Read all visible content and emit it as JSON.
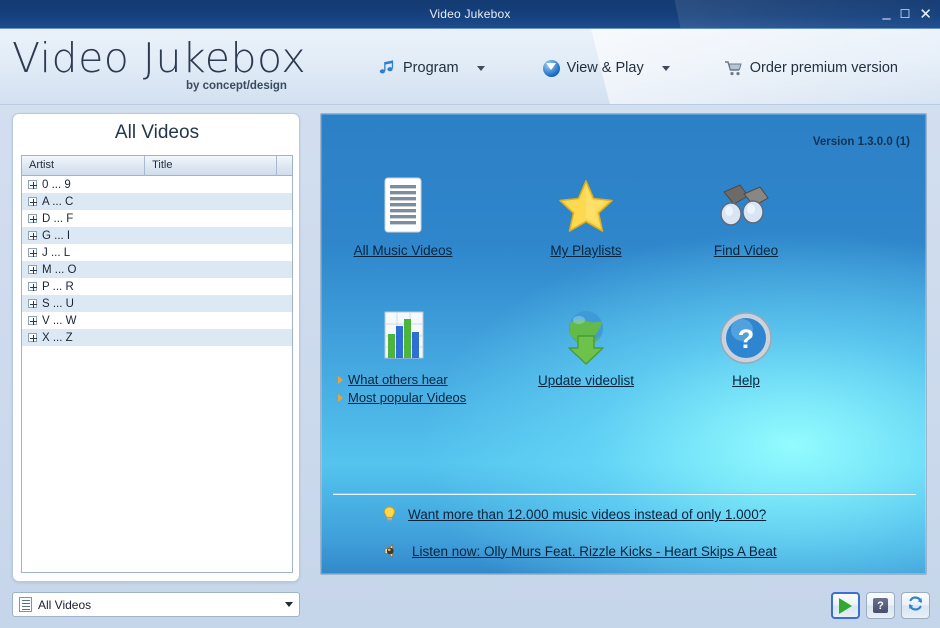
{
  "window": {
    "title": "Video Jukebox",
    "minimize": "–",
    "maximize": "❐",
    "close": "✕"
  },
  "header": {
    "brand": "Video Jukebox",
    "brand_sub": "by concept/design",
    "menu": [
      {
        "label": "Program",
        "icon": "music-note-icon",
        "has_caret": true
      },
      {
        "label": "View & Play",
        "icon": "download-circle-icon",
        "has_caret": true
      },
      {
        "label": "Order premium version",
        "icon": "shopping-cart-icon",
        "has_caret": false
      }
    ]
  },
  "sidebar": {
    "title": "All Videos",
    "columns": [
      "Artist",
      "Title"
    ],
    "rows": [
      "0 ... 9",
      "A ... C",
      "D ... F",
      "G ... I",
      "J ... L",
      "M ... O",
      "P ... R",
      "S ... U",
      "V ... W",
      "X ... Z"
    ],
    "combo": {
      "value": "All Videos",
      "icon": "list-icon"
    }
  },
  "main": {
    "version": "Version 1.3.0.0 (1)",
    "tiles": [
      {
        "label": "All Music Videos",
        "icon": "document-lines-icon"
      },
      {
        "label": "My Playlists",
        "icon": "star-icon"
      },
      {
        "label": "Find Video",
        "icon": "binoculars-icon"
      },
      {
        "label": "",
        "icon": "bar-chart-icon"
      },
      {
        "label": "Update videolist",
        "icon": "globe-download-icon"
      },
      {
        "label": "Help",
        "icon": "question-help-icon"
      }
    ],
    "sublinks": [
      "What others hear",
      "Most popular Videos"
    ],
    "promos": [
      {
        "text": "Want more than 12.000 music videos instead of only 1.000?",
        "icon": "lightbulb-icon"
      },
      {
        "text": "Listen now: Olly Murs Feat. Rizzle Kicks - Heart Skips A Beat",
        "icon": "speaker-icon"
      }
    ]
  },
  "actions": {
    "play": "▶",
    "help": "?",
    "refresh": "↻"
  },
  "colors": {
    "titlebar": "#15407c",
    "panel_blue": "#2c80c6",
    "panel_cyan": "#54c4ee",
    "link": "#07253f",
    "accent_orange": "#e9a33c",
    "play_green": "#2faa2f"
  }
}
